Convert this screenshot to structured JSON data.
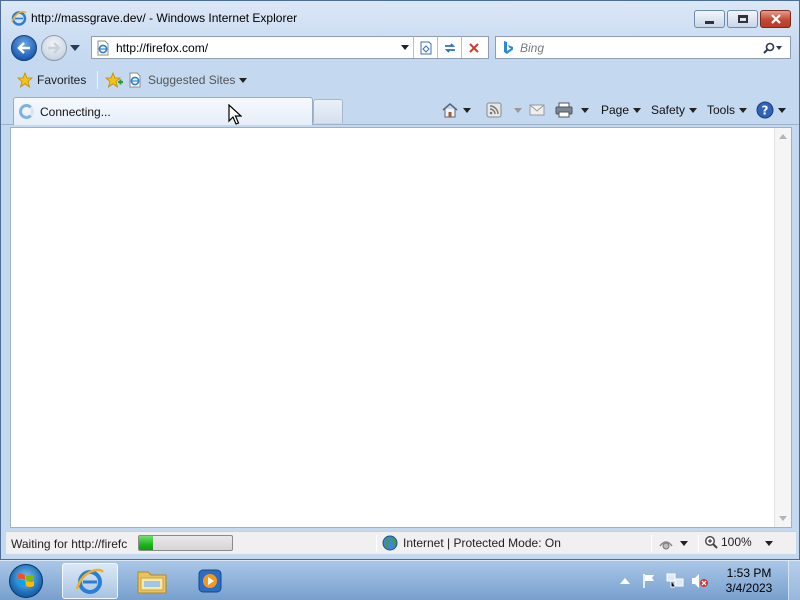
{
  "window": {
    "title": "http://massgrave.dev/ - Windows Internet Explorer",
    "caption_buttons": [
      "minimize",
      "maximize",
      "close"
    ]
  },
  "navigation": {
    "back_icon": "back-arrow-icon",
    "forward_icon": "forward-arrow-icon",
    "address_url": "http://firefox.com/",
    "search_placeholder": "Bing"
  },
  "favorites_bar": {
    "favorites_label": "Favorites",
    "suggested_sites_label": "Suggested Sites"
  },
  "tabs": [
    {
      "label": "Connecting...",
      "active": true
    }
  ],
  "command_bar": {
    "page_label": "Page",
    "safety_label": "Safety",
    "tools_label": "Tools"
  },
  "status_bar": {
    "status_text": "Waiting for http://firefc",
    "progress": 0.15,
    "zone_text": "Internet | Protected Mode: On",
    "zoom_text": "100%"
  },
  "taskbar": {
    "items": [
      "internet-explorer",
      "windows-explorer",
      "media-player"
    ],
    "time": "1:53 PM",
    "date": "3/4/2023"
  },
  "colors": {
    "titlebar": "#dbe7f6",
    "close_button": "#c24a36",
    "progress_fill": "#1fb51f",
    "taskbar": "#78a0cd"
  }
}
